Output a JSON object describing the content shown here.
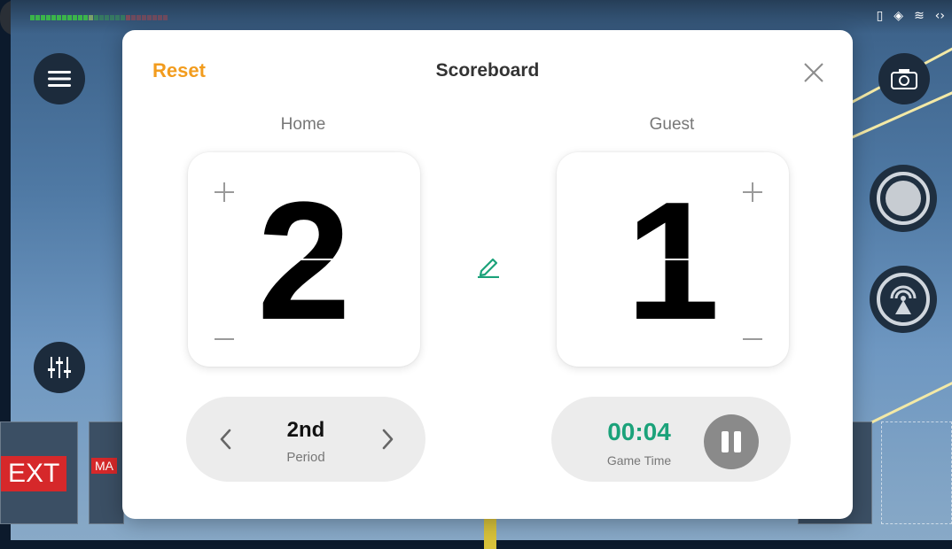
{
  "dialog": {
    "title": "Scoreboard",
    "reset_label": "Reset"
  },
  "home": {
    "label": "Home",
    "score": "2"
  },
  "guest": {
    "label": "Guest",
    "score": "1"
  },
  "period": {
    "value": "2nd",
    "label": "Period"
  },
  "timer": {
    "value": "00:04",
    "label": "Game Time"
  },
  "thumbnails": {
    "text_overlay": "EXT",
    "lower_third": "MA"
  },
  "colors": {
    "accent_reset": "#f29c1e",
    "accent_time": "#1ba27a",
    "edit_icon": "#1ba27a"
  },
  "icons": {
    "menu": "hamburger-icon",
    "camera": "camera-icon",
    "record": "record-icon",
    "live": "live-broadcast-icon",
    "mixer": "mixer-sliders-icon",
    "edit": "pencil-icon",
    "close": "close-icon"
  }
}
